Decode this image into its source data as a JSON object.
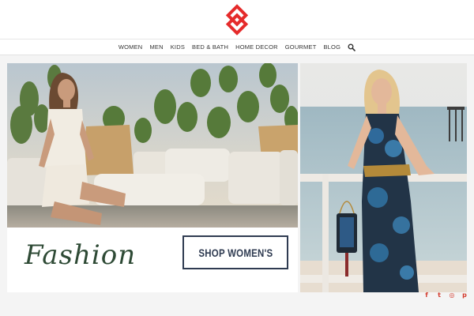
{
  "brand": {
    "accent_color": "#e52b2b"
  },
  "nav": {
    "items": [
      "WOMEN",
      "MEN",
      "KIDS",
      "BED & BATH",
      "HOME DECOR",
      "GOURMET",
      "BLOG"
    ],
    "search_icon": "search-icon"
  },
  "banner_left": {
    "script_text": "Fashion",
    "button_label": "SHOP WOMEN'S"
  },
  "social": {
    "icons": [
      "facebook-icon",
      "twitter-icon",
      "instagram-icon",
      "pinterest-icon"
    ],
    "glyphs": [
      "f",
      "t",
      "◎",
      "p"
    ],
    "color": "#d33a2c"
  }
}
